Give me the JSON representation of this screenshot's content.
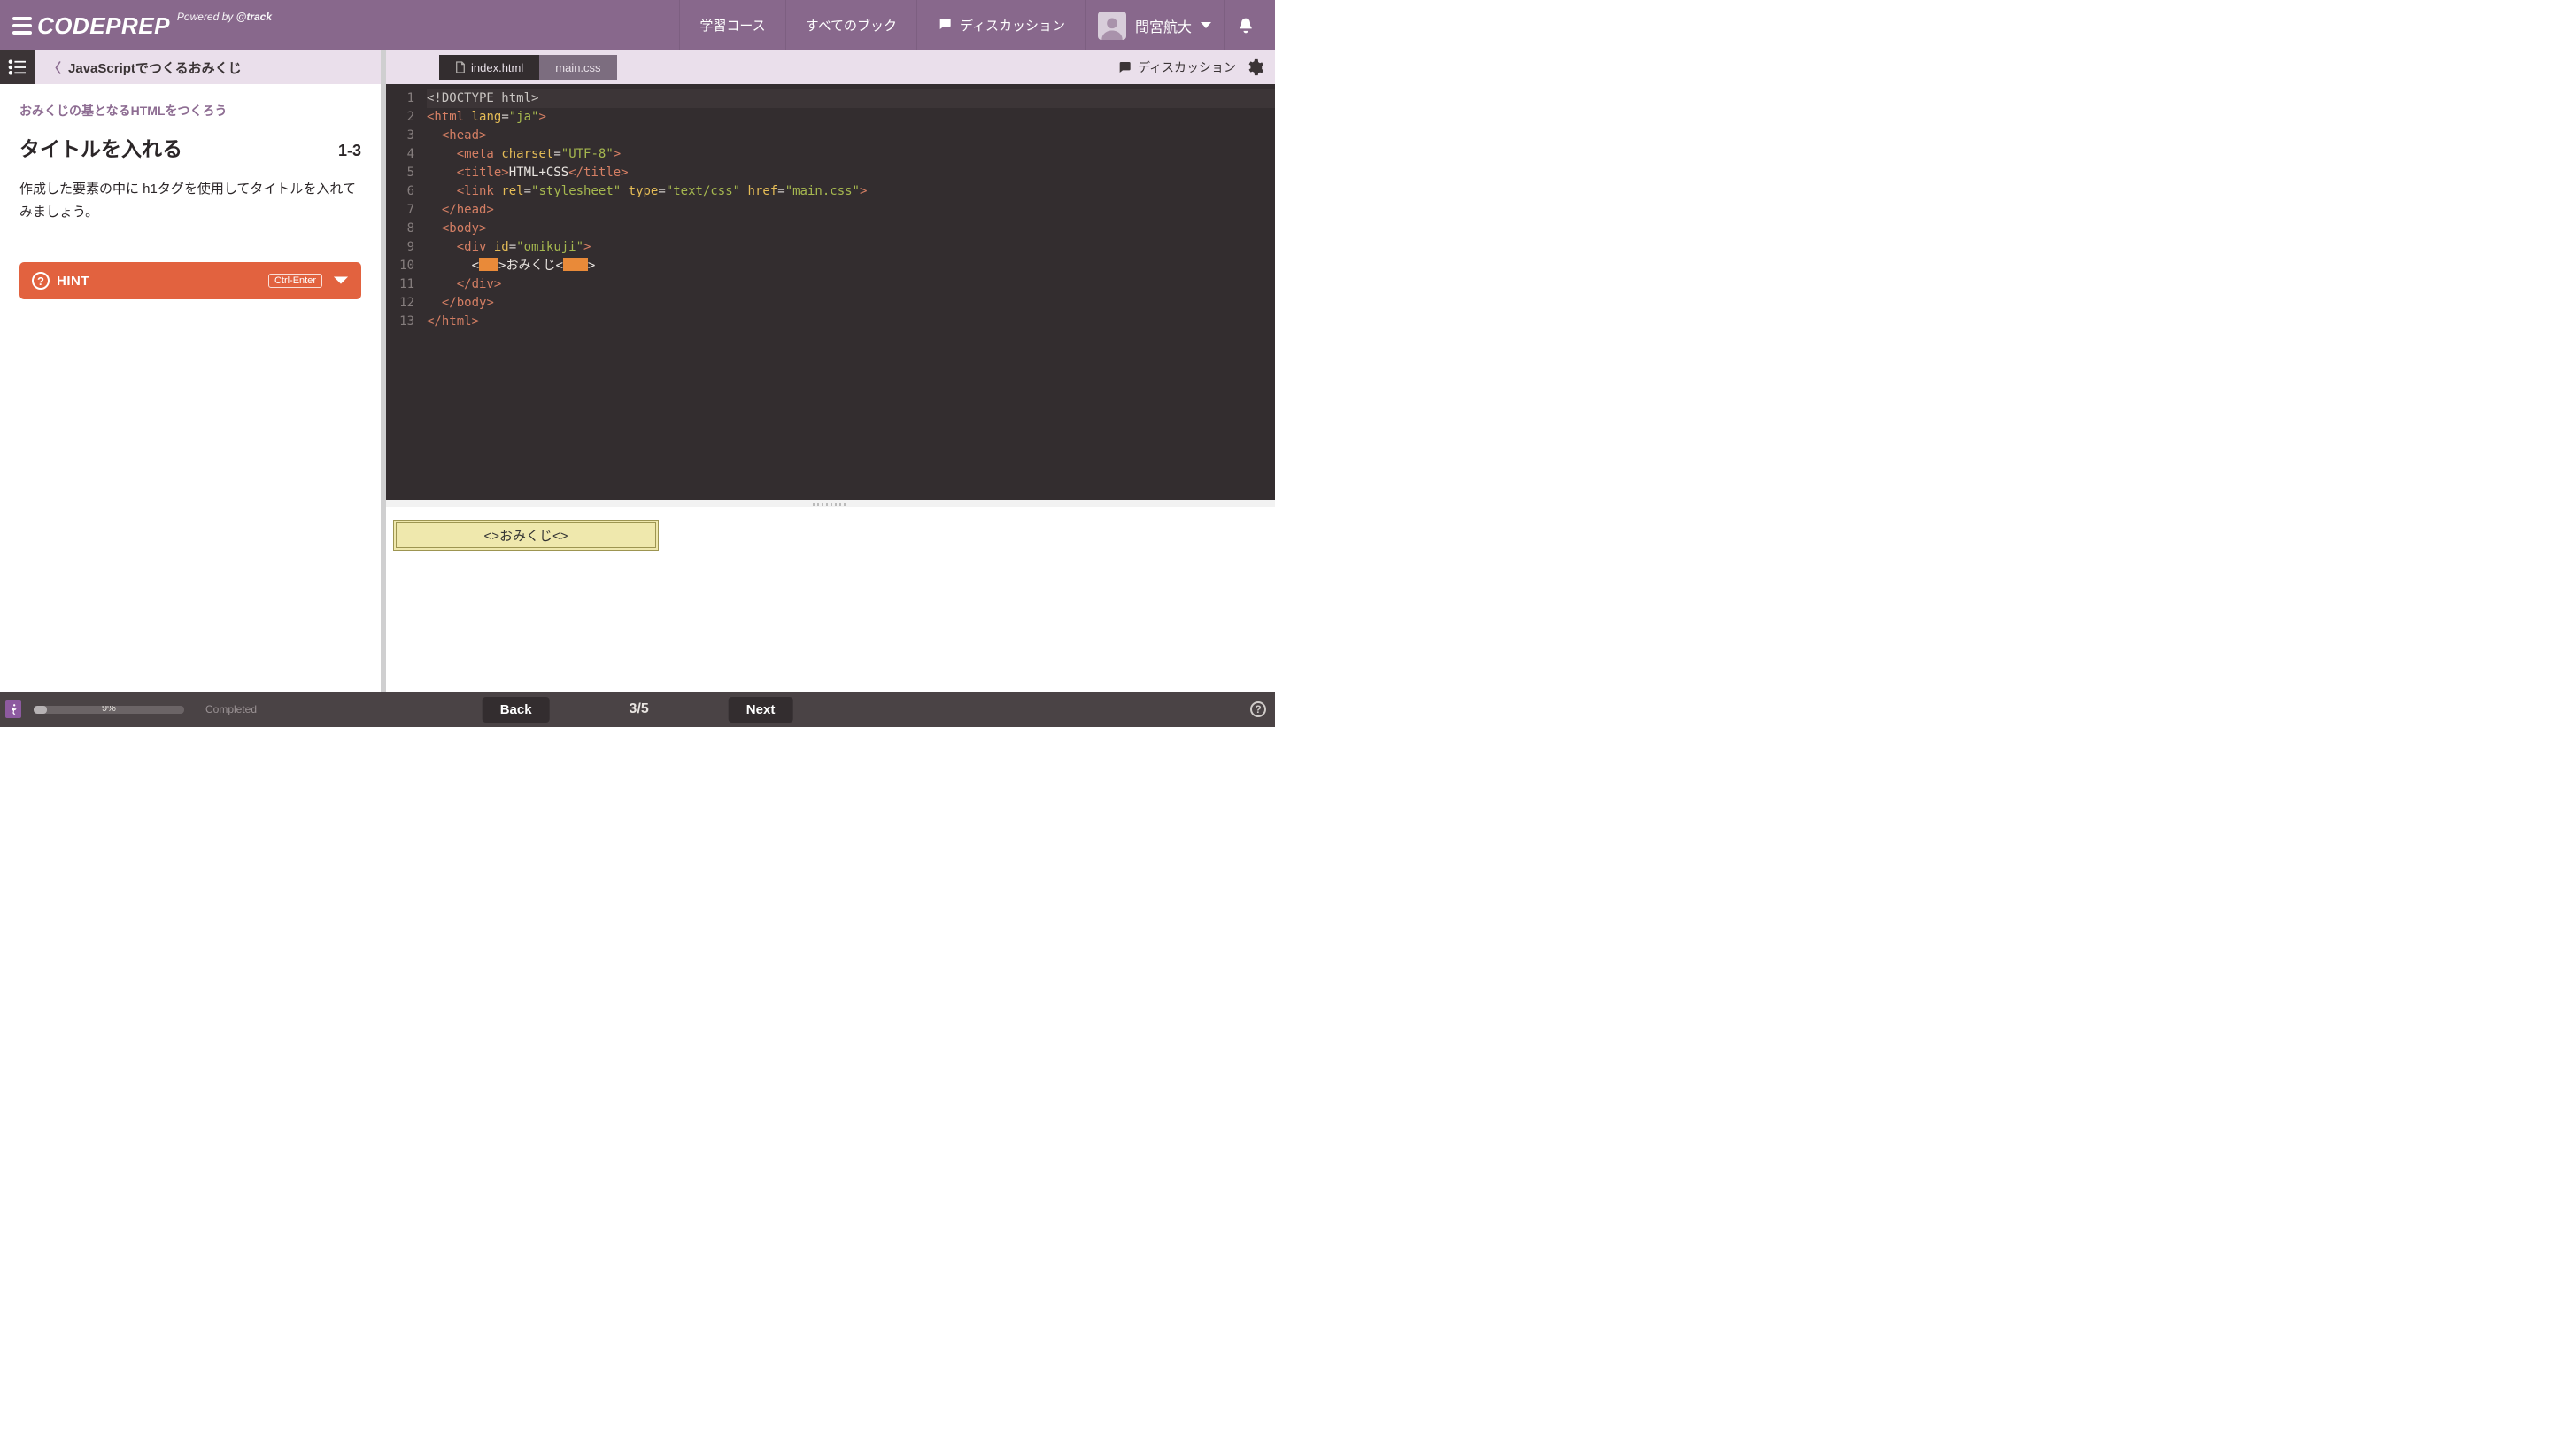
{
  "header": {
    "brand": "CODEPREP",
    "powered_prefix": "Powered by ",
    "powered_brand": "track",
    "nav": {
      "courses": "学習コース",
      "books": "すべてのブック",
      "discussion": "ディスカッション"
    },
    "user_name": "間宮航大"
  },
  "breadcrumb": {
    "title": "JavaScriptでつくるおみくじ"
  },
  "lesson": {
    "chapter_label": "おみくじの基となるHTMLをつくろう",
    "title": "タイトルを入れる",
    "number": "1-3",
    "description": "作成した要素の中に h1タグを使用してタイトルを入れてみましょう。",
    "hint_label": "HINT",
    "hint_shortcut": "Ctrl-Enter"
  },
  "tabs": {
    "active": "index.html",
    "inactive": "main.css"
  },
  "tool": {
    "discussion": "ディスカッション"
  },
  "code": {
    "line_count": 13,
    "l1": "<!DOCTYPE html>",
    "l5_text": "HTML+CSS",
    "l10_text": "おみくじ",
    "attrs": {
      "lang": "lang",
      "lang_v": "\"ja\"",
      "charset": "charset",
      "charset_v": "\"UTF-8\"",
      "rel": "rel",
      "rel_v": "\"stylesheet\"",
      "type": "type",
      "type_v": "\"text/css\"",
      "href": "href",
      "href_v": "\"main.css\"",
      "id": "id",
      "id_v": "\"omikuji\""
    },
    "tags": {
      "html": "html",
      "head": "head",
      "meta": "meta",
      "title": "title",
      "link": "link",
      "body": "body",
      "div": "div"
    }
  },
  "preview": {
    "content": "<>おみくじ<>"
  },
  "footer": {
    "percent": "9%",
    "progress_value": 9,
    "completed": "Completed",
    "back": "Back",
    "next": "Next",
    "page_indicator": "3/5"
  }
}
